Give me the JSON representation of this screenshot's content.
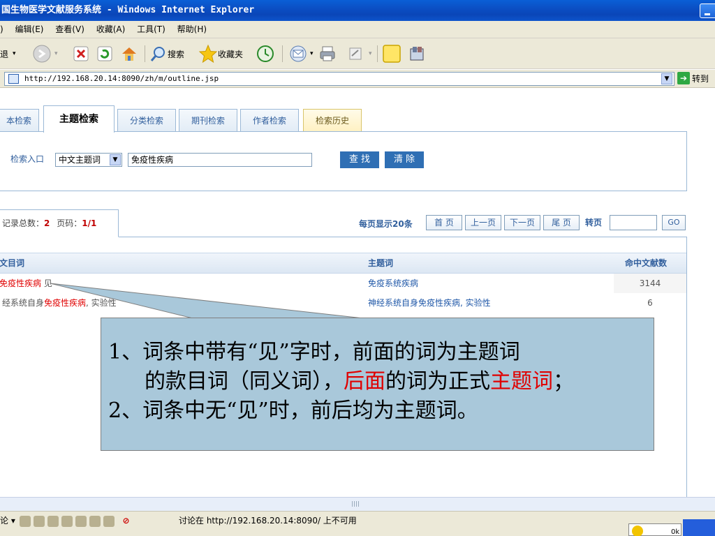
{
  "window": {
    "title": "国生物医学文献服务系统 - Windows Internet Explorer"
  },
  "menu": [
    ") ",
    "编辑(E)",
    "查看(V)",
    "收藏(A)",
    "工具(T)",
    "帮助(H)"
  ],
  "toolbar": {
    "back_label": "退",
    "search_label": "搜索",
    "favorites_label": "收藏夹"
  },
  "address": {
    "url": "http://192.168.20.14:8090/zh/m/outline.jsp",
    "go_label": "转到"
  },
  "tabs": [
    {
      "label": "本检索"
    },
    {
      "label": "主题检索"
    },
    {
      "label": "分类检索"
    },
    {
      "label": "期刊检索"
    },
    {
      "label": "作者检索"
    },
    {
      "label": "检索历史"
    }
  ],
  "search": {
    "entry_label": "检索入口",
    "field_value": "中文主题词",
    "query_value": "免疫性疾病",
    "find_button": "查找",
    "clear_button": "清除"
  },
  "results": {
    "total_label": "记录总数：",
    "total": "2",
    "page_label": "页码：",
    "page": "1/1",
    "per_page": "每页显示20条",
    "first": "首 页",
    "prev": "上一页",
    "next": "下一页",
    "last": "尾 页",
    "turn_page": "转页",
    "go": "GO"
  },
  "table": {
    "headers": [
      "文目词",
      "主题词",
      "命中文献数"
    ],
    "rows": [
      {
        "entry_pre": "",
        "entry_hl": "免疫性疾病",
        "entry_post": " 见",
        "term": "免疫系统疾病",
        "count": "3144"
      },
      {
        "entry_pre": "经系统自身",
        "entry_hl": "免疫性疾病",
        "entry_post": ", 实验性",
        "term": "神经系统自身免疫性疾病, 实验性",
        "count": "6"
      }
    ]
  },
  "callout": {
    "line1": "1、词条中带有“见”字时，前面的词为主题词",
    "line2_a": "的款目词（同义词），",
    "line2_b": "后面",
    "line2_c": "的词为正式",
    "line2_d": "主题词",
    "line2_e": "；",
    "line3": "2、词条中无“见”时，前后均为主题词。"
  },
  "status": {
    "left": "论 ▾",
    "text": "讨论在 http://192.168.20.14:8090/ 上不可用"
  },
  "tray": {
    "text": "0k"
  },
  "colors": {
    "title_blue": "#0b4fc4",
    "accent_blue": "#2f6fb4",
    "highlight_red": "#e00000",
    "callout_bg": "#a9c8da"
  }
}
